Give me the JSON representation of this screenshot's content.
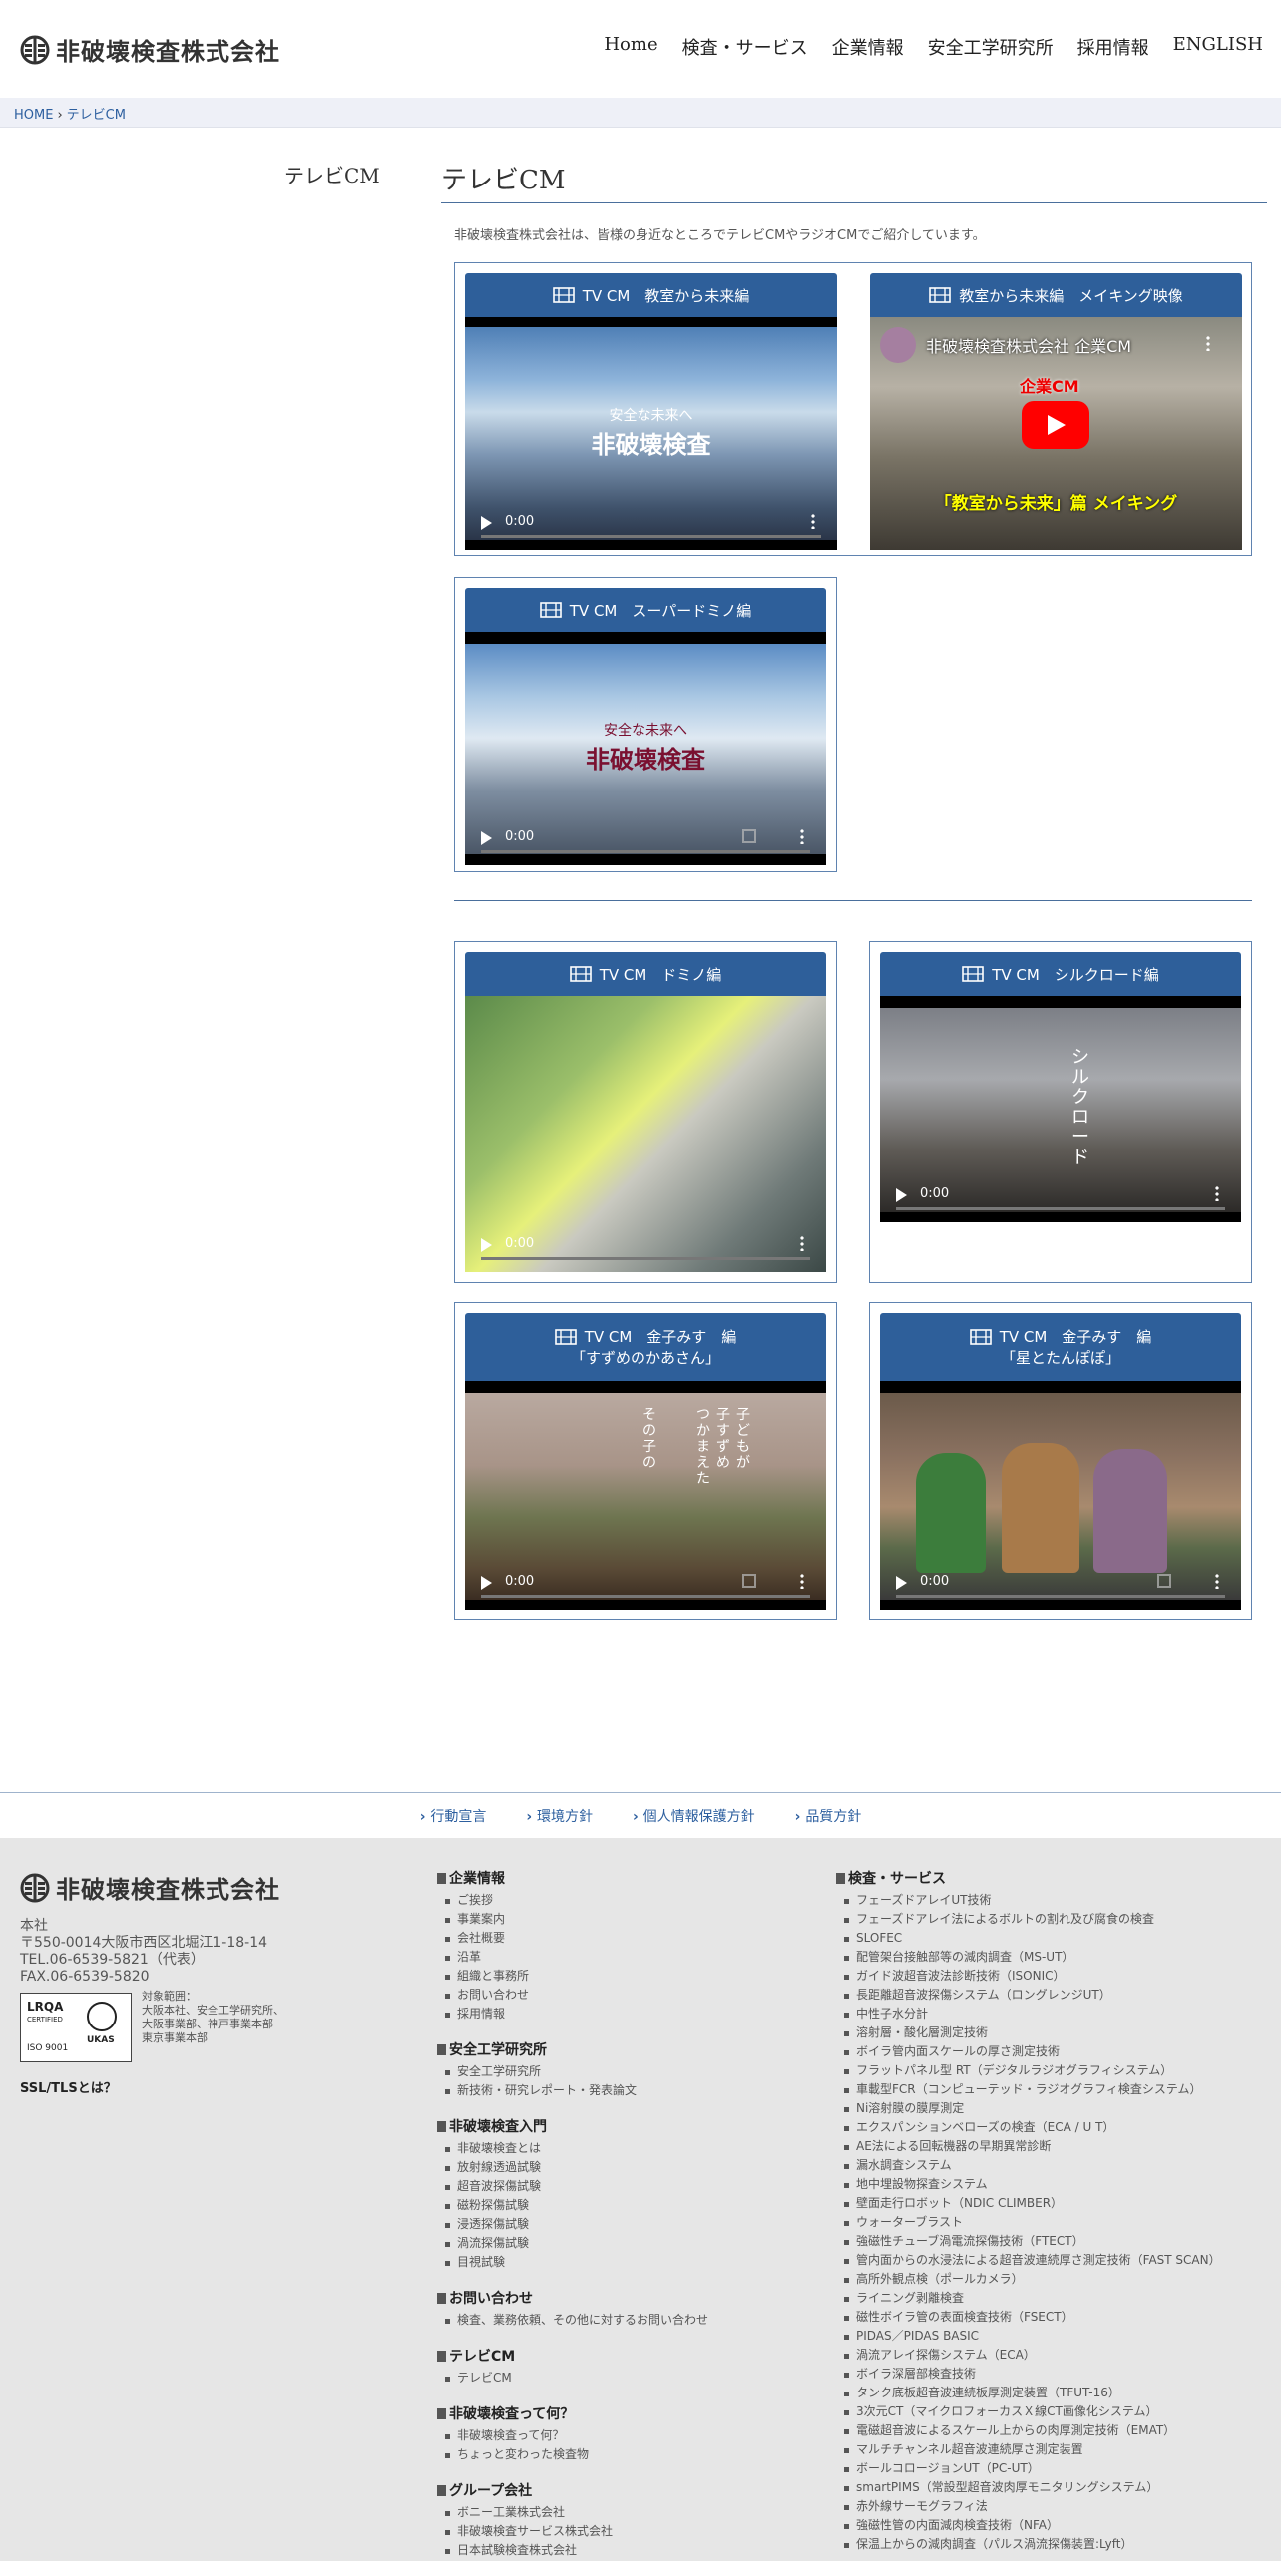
{
  "header": {
    "logo_text": "非破壊検査株式会社",
    "nav": [
      "Home",
      "検査・サービス",
      "企業情報",
      "安全工学研究所",
      "採用情報",
      "ENGLISH"
    ]
  },
  "breadcrumb": {
    "home": "HOME",
    "current": "テレビCM"
  },
  "side_title": "テレビCM",
  "main_title": "テレビCM",
  "intro": "非破壊検査株式会社は、皆様の身近なところでテレビCMやラジオCMでご紹介しています。",
  "videos": {
    "v1": {
      "title": "TV CM　教室から未来編",
      "time": "0:00",
      "overlay_top": "安全な未来へ",
      "overlay_logo": "非破壊検査"
    },
    "v2": {
      "title": "教室から未来編　メイキング映像",
      "yt_title": "非破壊検査株式会社 企業CM",
      "yt_banner": "企業CM",
      "yt_caption": "「教室から未来」篇 メイキング"
    },
    "v3": {
      "title": "TV CM　スーパードミノ編",
      "time": "0:00",
      "overlay_top": "安全な未来へ",
      "overlay_logo": "非破壊検査"
    },
    "v4": {
      "title": "TV CM　ドミノ編",
      "time": "0:00"
    },
    "v5": {
      "title": "TV CM　シルクロード編",
      "time": "0:00",
      "overlay_text": "シルクロード"
    },
    "v6": {
      "title": "TV CM　金子みす　編",
      "subtitle": "「すずめのかあさん」",
      "time": "0:00",
      "overlay_text1": "子どもが",
      "overlay_text2": "子すずめ",
      "overlay_text3": "つかまえた",
      "overlay_text4": "その子の"
    },
    "v7": {
      "title": "TV CM　金子みす　編",
      "subtitle": "「星とたんぽぽ」",
      "time": "0:00"
    }
  },
  "footer_links": [
    "行動宣言",
    "環境方針",
    "個人情報保護方針",
    "品質方針"
  ],
  "footer": {
    "logo_text": "非破壊検査株式会社",
    "office": "本社",
    "address": "〒550-0014大阪市西区北堀江1-18-14",
    "tel": "TEL.06-6539-5821（代表）",
    "fax": "FAX.06-6539-5820",
    "iso_label1": "LRQA",
    "iso_label2": "CERTIFIED",
    "iso_label3": "ISO 9001",
    "iso_label4": "UKAS",
    "iso_scope": "対象範囲：",
    "iso_scope1": "大阪本社、安全工学研究所、",
    "iso_scope2": "大阪事業部、神戸事業本部",
    "iso_scope3": "東京事業本部",
    "ssl": "SSL/TLSとは？",
    "col2": [
      {
        "heading": "企業情報",
        "items": [
          "ご挨拶",
          "事業案内",
          "会社概要",
          "沿革",
          "組織と事務所",
          "お問い合わせ",
          "採用情報"
        ]
      },
      {
        "heading": "安全工学研究所",
        "items": [
          "安全工学研究所",
          "新技術・研究レポート・発表論文"
        ]
      },
      {
        "heading": "非破壊検査入門",
        "items": [
          "非破壊検査とは",
          "放射線透過試験",
          "超音波探傷試験",
          "磁粉探傷試験",
          "浸透探傷試験",
          "渦流探傷試験",
          "目視試験"
        ]
      },
      {
        "heading": "お問い合わせ",
        "items": [
          "検査、業務依頼、その他に対するお問い合わせ"
        ]
      },
      {
        "heading": "テレビCM",
        "items": [
          "テレビCM"
        ]
      },
      {
        "heading": "非破壊検査って何？",
        "items": [
          "非破壊検査って何？",
          "ちょっと変わった検査物"
        ]
      },
      {
        "heading": "グループ会社",
        "items": [
          "ボニー工業株式会社",
          "非破壊検査サービス株式会社",
          "日本試験検査株式会社"
        ]
      }
    ],
    "col3": [
      {
        "heading": "検査・サービス",
        "items": [
          "フェーズドアレイUT技術",
          "フェーズドアレイ法によるボルトの割れ及び腐食の検査",
          "SLOFEC",
          "配管架台接触部等の減肉調査（MS-UT）",
          "ガイド波超音波法診断技術（ISONIC）",
          "長距離超音波探傷システム（ロングレンジUT）",
          "中性子水分計",
          "溶射層・酸化層測定技術",
          "ボイラ管内面スケールの厚さ測定技術",
          "フラットパネル型 RT（デジタルラジオグラフィシステム）",
          "車載型FCR（コンピューテッド・ラジオグラフィ検査システム）",
          "Ni溶射膜の膜厚測定",
          "エクスパンションベローズの検査（ECA / U T）",
          "AE法による回転機器の早期異常診断",
          "漏水調査システム",
          "地中埋設物探査システム",
          "壁面走行ロボット（NDIC CLIMBER）",
          "ウォーターブラスト",
          "強磁性チューブ渦電流探傷技術（FTECT）",
          "管内面からの水浸法による超音波連続厚さ測定技術（FAST SCAN）",
          "高所外観点検（ポールカメラ）",
          "ライニング剥離検査",
          "磁性ボイラ管の表面検査技術（FSECT）",
          "PIDAS／PIDAS BASIC",
          "渦流アレイ探傷システム（ECA）",
          "ボイラ深層部検査技術",
          "タンク底板超音波連続板厚測定装置（TFUT-16）",
          "3次元CT（マイクロフォーカスＸ線CT画像化システム）",
          "電磁超音波によるスケール上からの肉厚測定技術（EMAT）",
          "マルチチャンネル超音波連続厚さ測定装置",
          "ボールコロージョンUT（PC-UT）",
          "smartPIMS（常設型超音波肉厚モニタリングシステム）",
          "赤外線サーモグラフィ法",
          "強磁性管の内面減肉検査技術（NFA）",
          "保温上からの減肉調査（パルス渦流探傷装置:Lyft）"
        ]
      }
    ]
  }
}
